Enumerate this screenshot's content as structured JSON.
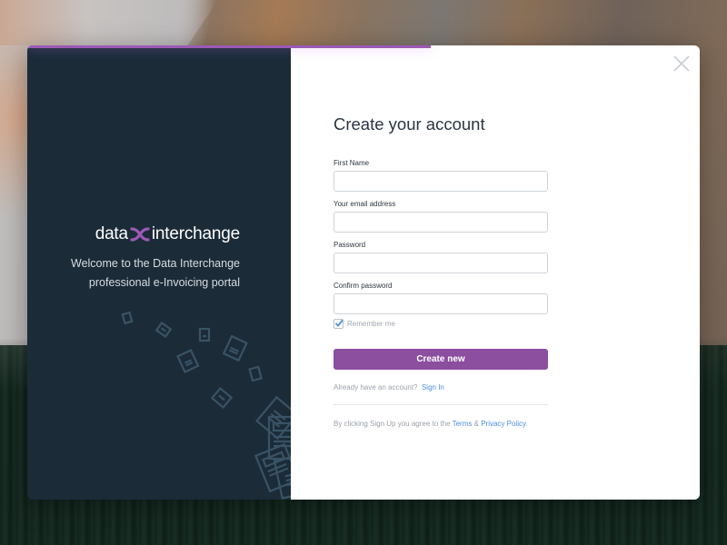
{
  "background": {
    "description": "mountain-cliff-forest-photo"
  },
  "modal": {
    "progress_percent": 60,
    "accent_color": "#9b59b6",
    "left_panel": {
      "brand": {
        "word1": "data",
        "word2": "interchange",
        "mark_color": "#9b59b6"
      },
      "welcome_line1": "Welcome to the Data Interchange",
      "welcome_line2": "professional e-Invoicing portal",
      "decoration": "floating-documents-illustration"
    },
    "right_panel": {
      "close_icon": "close-x-icon",
      "title": "Create your account",
      "fields": [
        {
          "label": "First Name",
          "value": "",
          "placeholder": "",
          "type": "text"
        },
        {
          "label": "Your email address",
          "value": "",
          "placeholder": "",
          "type": "email"
        },
        {
          "label": "Password",
          "value": "",
          "placeholder": "",
          "type": "password"
        },
        {
          "label": "Confirm password",
          "value": "",
          "placeholder": "",
          "type": "password"
        }
      ],
      "remember_me": {
        "label": "Remember me",
        "checked": true
      },
      "submit_label": "Create new",
      "button_color": "#8c4e9f",
      "already_text": "Already have an account?",
      "sign_in_label": "Sign In",
      "terms_prefix": "By clicking Sign Up you agree to the",
      "terms_label": "Terms",
      "terms_amp": "&",
      "privacy_label": "Privacy Policy",
      "terms_suffix": ".",
      "link_color": "#4a90e2"
    }
  }
}
